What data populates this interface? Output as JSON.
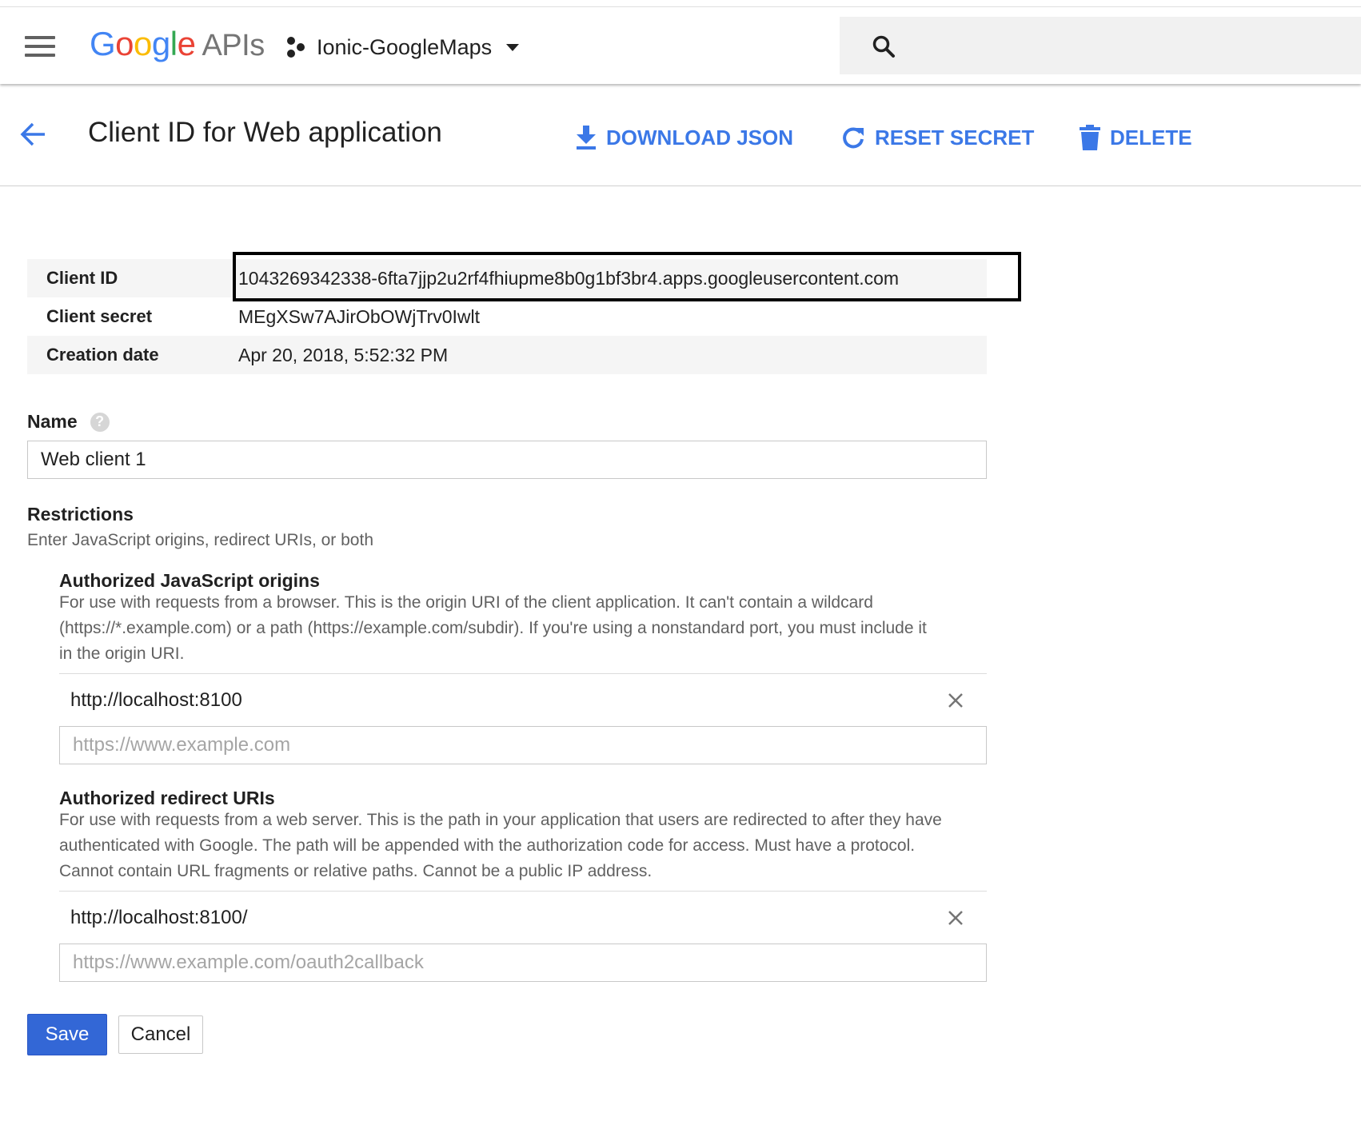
{
  "app": {
    "logo_google": [
      "G",
      "o",
      "o",
      "g",
      "l",
      "e"
    ],
    "logo_google_colors": [
      "#4285F4",
      "#EA4335",
      "#FBBC05",
      "#4285F4",
      "#34A853",
      "#EA4335"
    ],
    "logo_apis": "APIs",
    "project_name": "Ionic-GoogleMaps",
    "icons": {
      "menu": "hamburger-menu-icon",
      "project": "project-hexagon-icon",
      "project_dropdown": "chevron-down-icon",
      "search": "search-icon"
    }
  },
  "header": {
    "title": "Client ID for Web application",
    "actions": {
      "download": "DOWNLOAD JSON",
      "reset": "RESET SECRET",
      "delete": "DELETE"
    },
    "accent_color": "#3b78e7"
  },
  "client_info": {
    "rows": [
      {
        "label": "Client ID",
        "value": "1043269342338-6fta7jjp2u2rf4fhiupme8b0g1bf3br4.apps.googleusercontent.com"
      },
      {
        "label": "Client secret",
        "value": "MEgXSw7AJirObOWjTrv0Iwlt"
      },
      {
        "label": "Creation date",
        "value": "Apr 20, 2018, 5:52:32 PM"
      }
    ]
  },
  "name_field": {
    "label": "Name",
    "help": "?",
    "value": "Web client 1"
  },
  "restrictions": {
    "title": "Restrictions",
    "description": "Enter JavaScript origins, redirect URIs, or both",
    "js_origins": {
      "title": "Authorized JavaScript origins",
      "description_lines": [
        "For use with requests from a browser. This is the origin URI of the client application. It can't contain a wildcard",
        "(https://*.example.com) or a path (https://example.com/subdir). If you're using a nonstandard port, you must include it",
        "in the origin URI."
      ],
      "items": [
        "http://localhost:8100"
      ],
      "placeholder": "https://www.example.com"
    },
    "redirect_uris": {
      "title": "Authorized redirect URIs",
      "description_lines": [
        "For use with requests from a web server. This is the path in your application that users are redirected to after they have",
        "authenticated with Google. The path will be appended with the authorization code for access. Must have a protocol.",
        "Cannot contain URL fragments or relative paths. Cannot be a public IP address."
      ],
      "items": [
        "http://localhost:8100/"
      ],
      "placeholder": "https://www.example.com/oauth2callback"
    }
  },
  "buttons": {
    "save": "Save",
    "cancel": "Cancel",
    "primary_color": "#3367d6"
  }
}
